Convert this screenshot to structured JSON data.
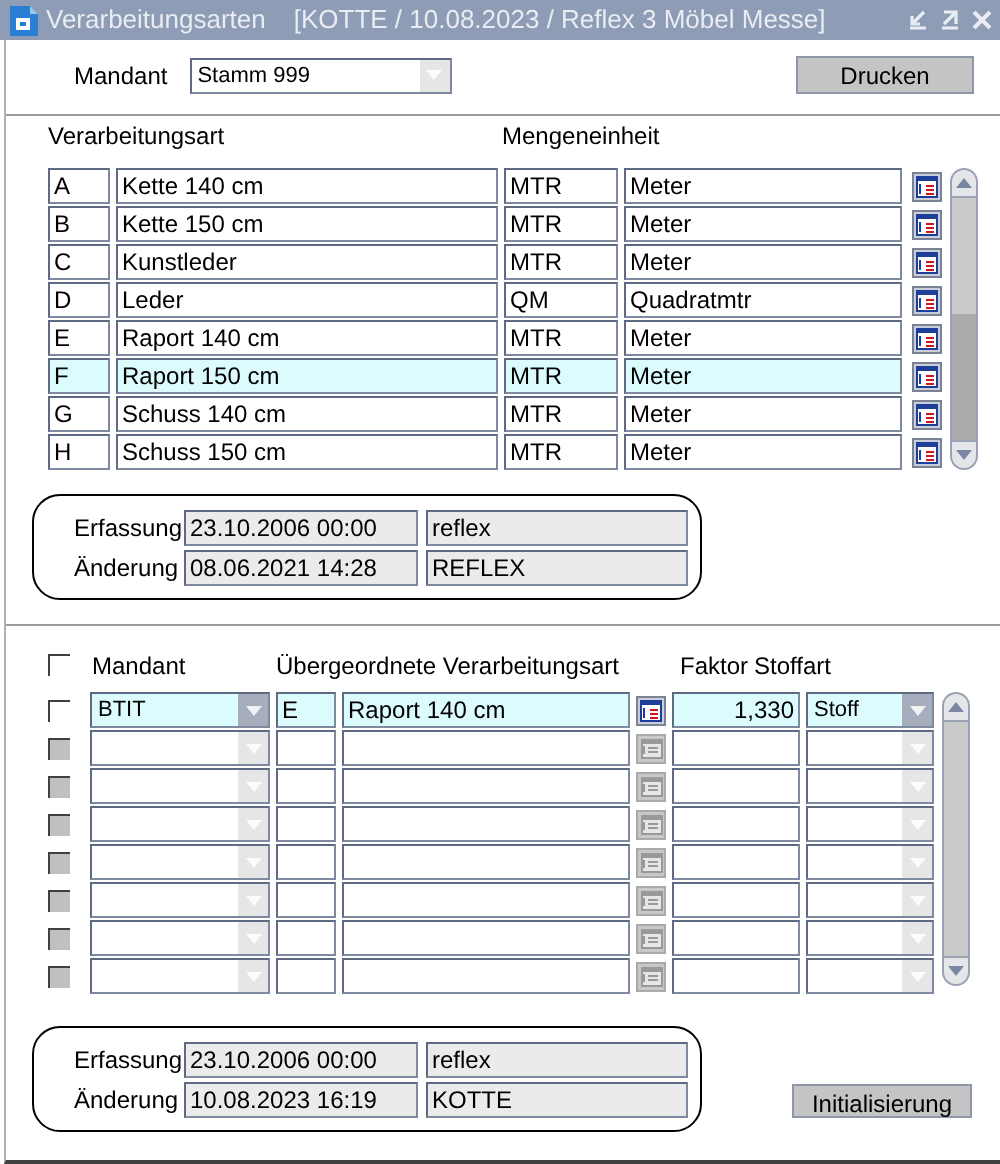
{
  "window": {
    "title": "Verarbeitungsarten",
    "context": "[KOTTE / 10.08.2023 / Reflex 3 Möbel Messe]"
  },
  "header": {
    "mandant_label": "Mandant",
    "mandant_value": "Stamm 999",
    "print_button": "Drucken"
  },
  "processing_types": {
    "columns": [
      "Verarbeitungsart",
      "Mengeneinheit"
    ],
    "rows": [
      {
        "code": "A",
        "name": "Kette 140 cm",
        "unit": "MTR",
        "unit_name": "Meter",
        "selected": false
      },
      {
        "code": "B",
        "name": "Kette 150 cm",
        "unit": "MTR",
        "unit_name": "Meter",
        "selected": false
      },
      {
        "code": "C",
        "name": "Kunstleder",
        "unit": "MTR",
        "unit_name": "Meter",
        "selected": false
      },
      {
        "code": "D",
        "name": "Leder",
        "unit": "QM",
        "unit_name": "Quadratmtr",
        "selected": false
      },
      {
        "code": "E",
        "name": "Raport 140 cm",
        "unit": "MTR",
        "unit_name": "Meter",
        "selected": false
      },
      {
        "code": "F",
        "name": "Raport 150 cm",
        "unit": "MTR",
        "unit_name": "Meter",
        "selected": true
      },
      {
        "code": "G",
        "name": "Schuss 140 cm",
        "unit": "MTR",
        "unit_name": "Meter",
        "selected": false
      },
      {
        "code": "H",
        "name": "Schuss 150 cm",
        "unit": "MTR",
        "unit_name": "Meter",
        "selected": false
      }
    ]
  },
  "info_top": {
    "created_label": "Erfassung",
    "created_date": "23.10.2006 00:00",
    "created_by": "reflex",
    "changed_label": "Änderung",
    "changed_date": "08.06.2021 14:28",
    "changed_by": "REFLEX"
  },
  "assignments": {
    "select_all_checked": false,
    "columns": [
      "Mandant",
      "Übergeordnete Verarbeitungsart",
      "Faktor",
      "Stoffart"
    ],
    "rows": [
      {
        "checked": false,
        "selected": true,
        "disabled": false,
        "mandant": "BTIT",
        "code": "E",
        "name": "Raport 140 cm",
        "factor": "1,330",
        "fabric_type": "Stoff"
      },
      {
        "checked": false,
        "selected": false,
        "disabled": true
      },
      {
        "checked": false,
        "selected": false,
        "disabled": true
      },
      {
        "checked": false,
        "selected": false,
        "disabled": true
      },
      {
        "checked": false,
        "selected": false,
        "disabled": true
      },
      {
        "checked": false,
        "selected": false,
        "disabled": true
      },
      {
        "checked": false,
        "selected": false,
        "disabled": true
      },
      {
        "checked": false,
        "selected": false,
        "disabled": true
      }
    ]
  },
  "info_bottom": {
    "created_label": "Erfassung",
    "created_date": "23.10.2006 00:00",
    "created_by": "reflex",
    "changed_label": "Änderung",
    "changed_date": "10.08.2023 16:19",
    "changed_by": "KOTTE"
  },
  "init_button": "Initialisierung"
}
